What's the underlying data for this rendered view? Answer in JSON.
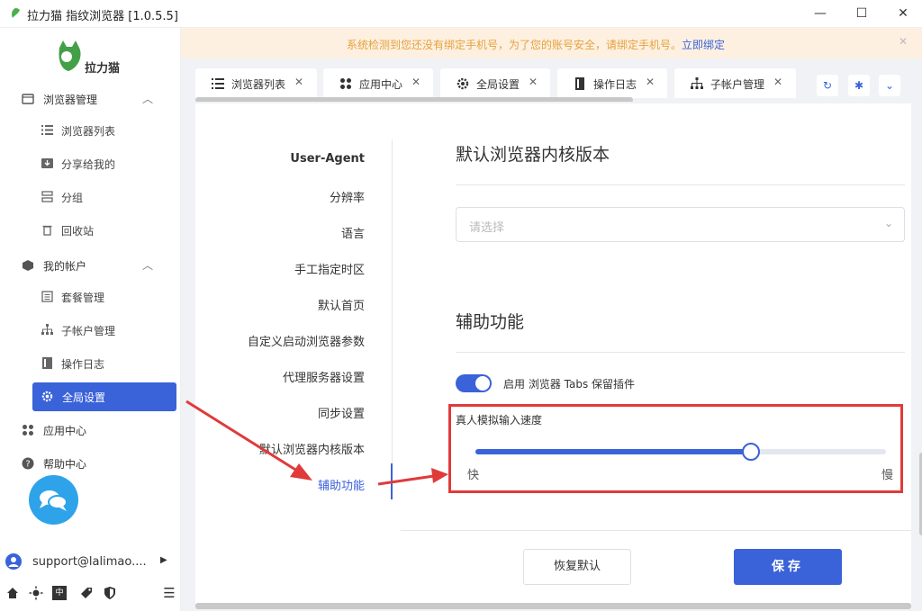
{
  "window": {
    "title": "拉力猫 指纹浏览器 [1.0.5.5]",
    "controls": {
      "minimize": "—",
      "maximize": "☐",
      "close": "✕"
    }
  },
  "brand": {
    "name": "拉力猫"
  },
  "sidebar": {
    "groups": [
      {
        "label": "浏览器管理",
        "icon": "browser-icon",
        "expanded": true
      },
      {
        "label": "我的帐户",
        "icon": "account-icon",
        "expanded": true
      },
      {
        "label": "应用中心",
        "icon": "apps-icon"
      },
      {
        "label": "帮助中心",
        "icon": "help-icon"
      }
    ],
    "browser_items": [
      {
        "label": "浏览器列表",
        "icon": "list-icon"
      },
      {
        "label": "分享给我的",
        "icon": "share-icon"
      },
      {
        "label": "分组",
        "icon": "group-icon"
      },
      {
        "label": "回收站",
        "icon": "trash-icon"
      }
    ],
    "account_items": [
      {
        "label": "套餐管理",
        "icon": "package-icon"
      },
      {
        "label": "子帐户管理",
        "icon": "sub-account-icon"
      },
      {
        "label": "操作日志",
        "icon": "log-icon"
      },
      {
        "label": "全局设置",
        "icon": "gear-icon",
        "active": true
      }
    ],
    "account": {
      "email": "support@lalimao....",
      "arrow": "▶"
    },
    "bottom_tools": [
      "home-icon",
      "sun-icon",
      "language-icon",
      "tag-icon",
      "shield-icon",
      "collapse-icon"
    ],
    "language_label": "中",
    "collapse_label": "☰"
  },
  "notice": {
    "message": "系统检测到您还没有绑定手机号，为了您的账号安全，请绑定手机号。",
    "link": "立即绑定",
    "close": "✕"
  },
  "tabs": [
    {
      "label": "浏览器列表",
      "icon": "list-icon"
    },
    {
      "label": "应用中心",
      "icon": "apps-icon"
    },
    {
      "label": "全局设置",
      "icon": "gear-icon",
      "active": true
    },
    {
      "label": "操作日志",
      "icon": "log-icon"
    },
    {
      "label": "子帐户管理",
      "icon": "sub-account-icon"
    }
  ],
  "tab_close": "✕",
  "tab_tools": {
    "refresh": "↻",
    "settings": "✱",
    "more": "⌄"
  },
  "settings_nav": [
    "User-Agent",
    "分辨率",
    "语言",
    "手工指定时区",
    "默认首页",
    "自定义启动浏览器参数",
    "代理服务器设置",
    "同步设置",
    "默认浏览器内核版本",
    "辅助功能"
  ],
  "settings_nav_active": "辅助功能",
  "kernel": {
    "title": "默认浏览器内核版本",
    "placeholder": "请选择",
    "chevron": "⌄"
  },
  "assist": {
    "title": "辅助功能",
    "toggle_label": "启用 浏览器 Tabs 保留插件",
    "toggle_on": true,
    "slider_title": "真人模拟输入速度",
    "slider_min": "快",
    "slider_max": "慢",
    "slider_value": 0.67
  },
  "buttons": {
    "reset": "恢复默认",
    "save": "保存"
  },
  "colors": {
    "primary": "#3a62d9",
    "annotation": "#e03a3a",
    "notice_text": "#e6a23c"
  }
}
